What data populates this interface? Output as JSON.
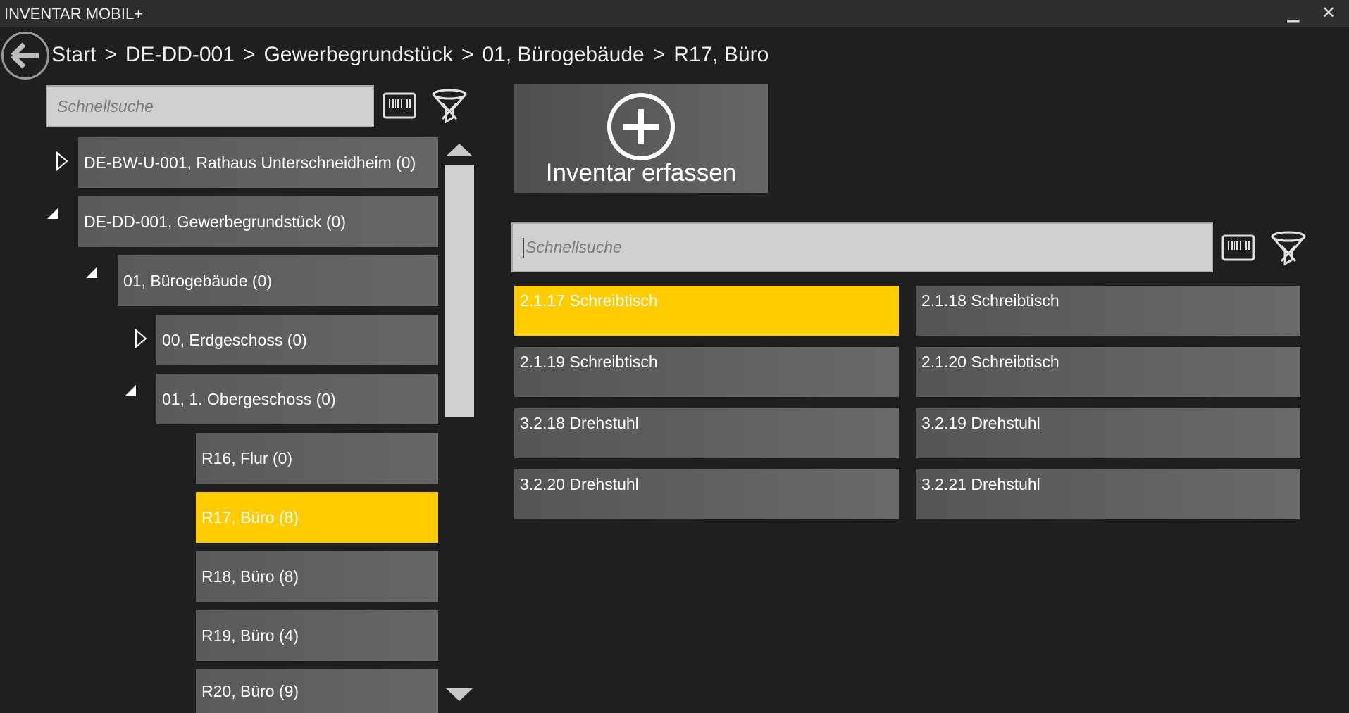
{
  "window": {
    "title": "INVENTAR MOBIL+",
    "minimize": "▁",
    "close": "✕"
  },
  "breadcrumb": {
    "items": [
      "Start",
      "DE-DD-001",
      "Gewerbegrundstück",
      "01, Bürogebäude",
      "R17, Büro"
    ],
    "separator": ">"
  },
  "left_panel": {
    "search_placeholder": "Schnellsuche",
    "tree": [
      {
        "label": "DE-BW-U-001, Rathaus Unterschneidheim (0)",
        "level": 0,
        "expander": "collapsed",
        "selected": false
      },
      {
        "label": "DE-DD-001, Gewerbegrundstück (0)",
        "level": 0,
        "expander": "expanded",
        "selected": false
      },
      {
        "label": "01, Bürogebäude (0)",
        "level": 1,
        "expander": "expanded",
        "selected": false
      },
      {
        "label": "00, Erdgeschoss (0)",
        "level": 2,
        "expander": "collapsed",
        "selected": false
      },
      {
        "label": "01, 1. Obergeschoss (0)",
        "level": 2,
        "expander": "expanded",
        "selected": false
      },
      {
        "label": "R16, Flur (0)",
        "level": 3,
        "expander": "none",
        "selected": false
      },
      {
        "label": "R17, Büro (8)",
        "level": 3,
        "expander": "none",
        "selected": true
      },
      {
        "label": "R18, Büro (8)",
        "level": 3,
        "expander": "none",
        "selected": false
      },
      {
        "label": "R19, Büro (4)",
        "level": 3,
        "expander": "none",
        "selected": false
      },
      {
        "label": "R20, Büro (9)",
        "level": 3,
        "expander": "none",
        "selected": false
      }
    ]
  },
  "right_panel": {
    "add_button_label": "Inventar erfassen",
    "search_placeholder": "Schnellsuche",
    "items": [
      {
        "label": "2.1.17 Schreibtisch",
        "selected": true
      },
      {
        "label": "2.1.18 Schreibtisch",
        "selected": false
      },
      {
        "label": "2.1.19 Schreibtisch",
        "selected": false
      },
      {
        "label": "2.1.20 Schreibtisch",
        "selected": false
      },
      {
        "label": "3.2.18 Drehstuhl",
        "selected": false
      },
      {
        "label": "3.2.19 Drehstuhl",
        "selected": false
      },
      {
        "label": "3.2.20 Drehstuhl",
        "selected": false
      },
      {
        "label": "3.2.21 Drehstuhl",
        "selected": false
      }
    ]
  },
  "colors": {
    "background": "#1f1f1f",
    "titlebar": "#2e2e2e",
    "tile": "#5f5f5f",
    "selected": "#ffcc00",
    "search_box": "#d0d0d0"
  },
  "icons": {
    "back": "arrow-left-circle-icon",
    "barcode": "barcode-icon",
    "filter_clear": "filter-clear-icon",
    "add": "plus-circle-icon",
    "scroll_up": "triangle-up-icon",
    "scroll_down": "triangle-down-icon"
  }
}
